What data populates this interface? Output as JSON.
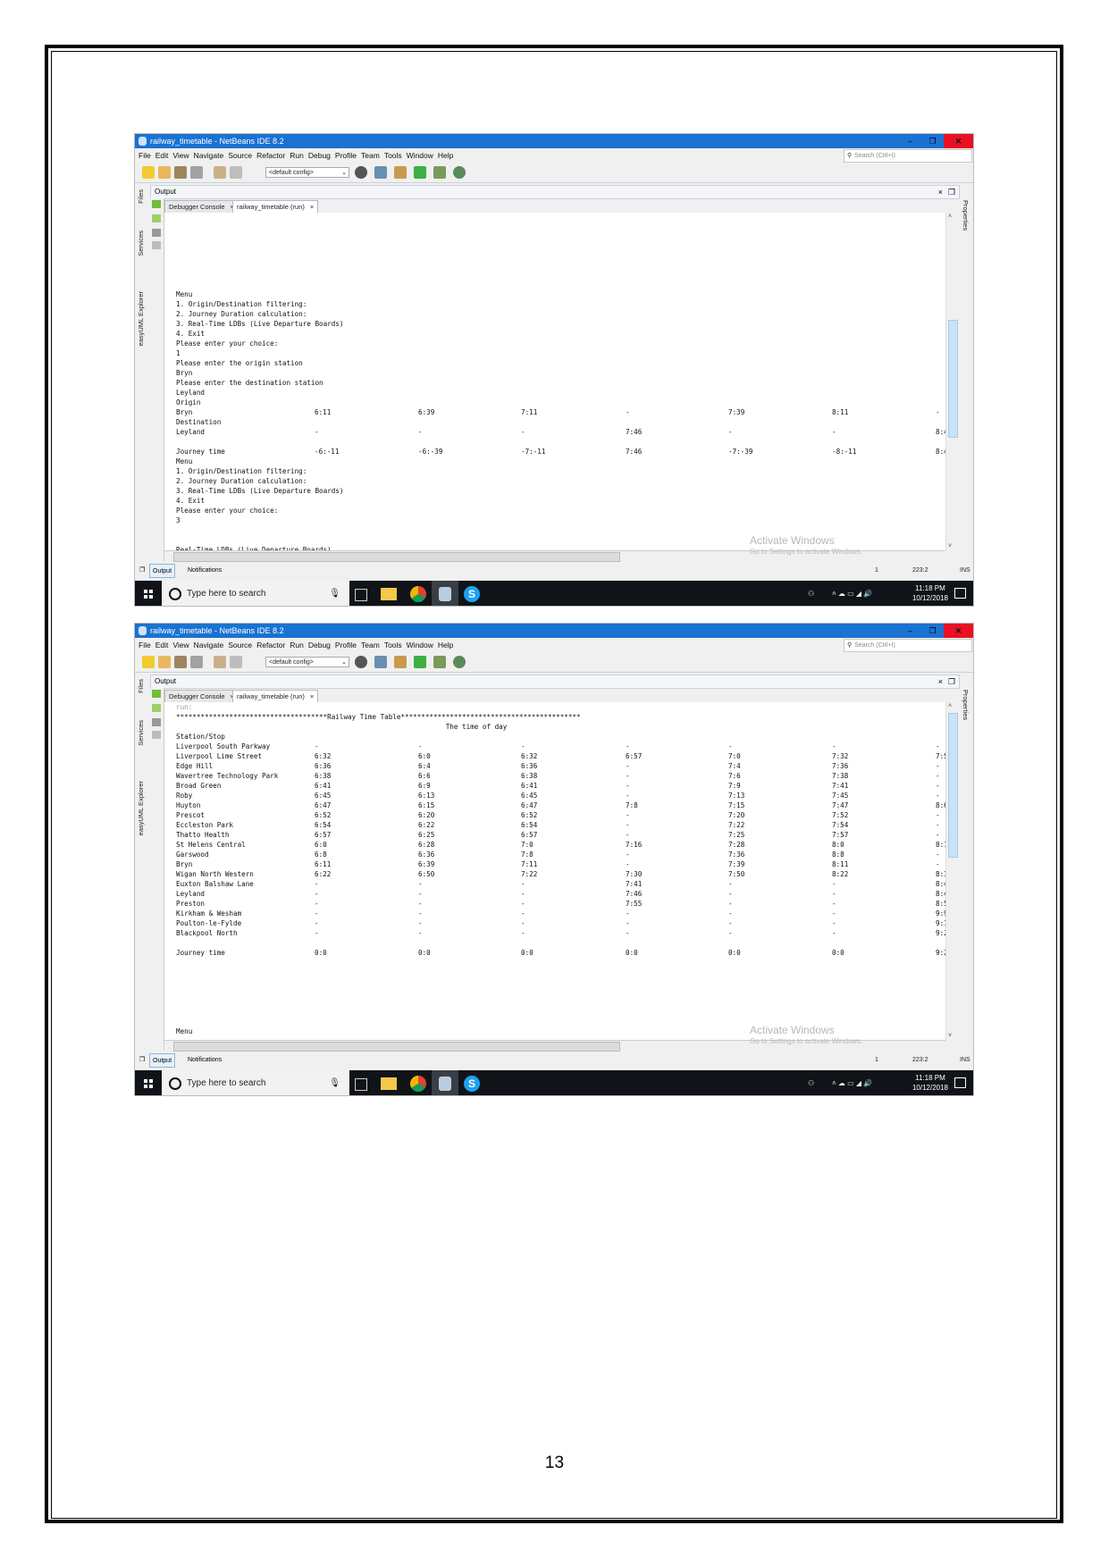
{
  "page_number": "13",
  "screens": [
    {
      "title": "railway_timetable - NetBeans IDE 8.2",
      "window_controls": {
        "minimize": "–",
        "maximize": "❐",
        "close": "✕"
      },
      "menu": [
        "File",
        "Edit",
        "View",
        "Navigate",
        "Source",
        "Refactor",
        "Run",
        "Debug",
        "Profile",
        "Team",
        "Tools",
        "Window",
        "Help"
      ],
      "search_placeholder": "Search (Ctrl+I)",
      "config": "<default config>",
      "output_label": "Output",
      "tabs": [
        "Debugger Console",
        "railway_timetable (run)"
      ],
      "left_panels": [
        "Files",
        "Services",
        "easyUML Explorer"
      ],
      "right_panels": [
        "Properties"
      ],
      "bottom_tabs": [
        "Output",
        "Notifications"
      ],
      "status": {
        "notifications": "1",
        "position": "223:2",
        "mode": "INS"
      },
      "watermark": {
        "title": "Activate Windows",
        "subtitle": "Go to Settings to activate Windows."
      },
      "taskbar": {
        "search_placeholder": "Type here to search",
        "time": "11:18 PM",
        "date": "10/12/2018"
      },
      "lines": [
        "Menu",
        "1. Origin/Destination filtering:",
        "2. Journey Duration calculation:",
        "3. Real-Time LDBs (Live Departure Boards)",
        "4. Exit",
        "Please enter your choice:",
        "1",
        "Please enter the origin station",
        "Bryn",
        "Please enter the destination station",
        "Leyland",
        "Origin",
        [
          "Bryn",
          "6:11",
          "6:39",
          "7:11",
          "-",
          "7:39",
          "8:11",
          "-"
        ],
        "Destination",
        [
          "Leyland",
          "-",
          "-",
          "-",
          "7:46",
          "-",
          "-",
          "8:4"
        ],
        "",
        [
          "Journey time",
          "-6:-11",
          "-6:-39",
          "-7:-11",
          "7:46",
          "-7:-39",
          "-8:-11",
          "8:4"
        ],
        "Menu",
        "1. Origin/Destination filtering:",
        "2. Journey Duration calculation:",
        "3. Real-Time LDBs (Live Departure Boards)",
        "4. Exit",
        "Please enter your choice:",
        "3",
        "",
        "",
        "Real-Time LDBs (Live Departure Boards)"
      ]
    },
    {
      "title": "railway_timetable - NetBeans IDE 8.2",
      "window_controls": {
        "minimize": "–",
        "maximize": "❐",
        "close": "✕"
      },
      "menu": [
        "File",
        "Edit",
        "View",
        "Navigate",
        "Source",
        "Refactor",
        "Run",
        "Debug",
        "Profile",
        "Team",
        "Tools",
        "Window",
        "Help"
      ],
      "search_placeholder": "Search (Ctrl+I)",
      "config": "<default config>",
      "output_label": "Output",
      "tabs": [
        "Debugger Console",
        "railway_timetable (run)"
      ],
      "left_panels": [
        "Files",
        "Services",
        "easyUML Explorer"
      ],
      "right_panels": [
        "Properties"
      ],
      "bottom_tabs": [
        "Output",
        "Notifications"
      ],
      "status": {
        "notifications": "1",
        "position": "223:2",
        "mode": "INS"
      },
      "watermark": {
        "title": "Activate Windows",
        "subtitle": "Go to Settings to activate Windows."
      },
      "taskbar": {
        "search_placeholder": "Type here to search",
        "time": "11:18 PM",
        "date": "10/12/2018"
      },
      "lines": [
        "run:",
        "*************************************Railway Time Table********************************************",
        "                                                                  The time of day",
        "Station/Stop",
        [
          "Liverpool South Parkway",
          "-",
          "-",
          "-",
          "-",
          "-",
          "-",
          "-"
        ],
        [
          "Liverpool Lime Street",
          "6:32",
          "6:0",
          "6:32",
          "6:57",
          "7:0",
          "7:32",
          "7:5"
        ],
        [
          "Edge Hill",
          "6:36",
          "6:4",
          "6:36",
          "-",
          "7:4",
          "7:36",
          "-"
        ],
        [
          "Wavertree Technology Park",
          "6:38",
          "6:6",
          "6:38",
          "-",
          "7:6",
          "7:38",
          "-"
        ],
        [
          "Broad Green",
          "6:41",
          "6:9",
          "6:41",
          "-",
          "7:9",
          "7:41",
          "-"
        ],
        [
          "Roby",
          "6:45",
          "6:13",
          "6:45",
          "-",
          "7:13",
          "7:45",
          "-"
        ],
        [
          "Huyton",
          "6:47",
          "6:15",
          "6:47",
          "7:8",
          "7:15",
          "7:47",
          "8:6"
        ],
        [
          "Prescot",
          "6:52",
          "6:20",
          "6:52",
          "-",
          "7:20",
          "7:52",
          "-"
        ],
        [
          "Eccleston Park",
          "6:54",
          "6:22",
          "6:54",
          "-",
          "7:22",
          "7:54",
          "-"
        ],
        [
          "Thatto Health",
          "6:57",
          "6:25",
          "6:57",
          "-",
          "7:25",
          "7:57",
          "-"
        ],
        [
          "St Helens Central",
          "6:0",
          "6:28",
          "7:0",
          "7:16",
          "7:28",
          "8:0",
          "8:1"
        ],
        [
          "Garswood",
          "6:8",
          "6:36",
          "7:8",
          "-",
          "7:36",
          "8:8",
          "-"
        ],
        [
          "Bryn",
          "6:11",
          "6:39",
          "7:11",
          "-",
          "7:39",
          "8:11",
          "-"
        ],
        [
          "Wigan North Western",
          "6:22",
          "6:50",
          "7:22",
          "7:30",
          "7:50",
          "8:22",
          "8:3"
        ],
        [
          "Euxton Balshaw Lane",
          "-",
          "-",
          "-",
          "7:41",
          "-",
          "-",
          "8:4"
        ],
        [
          "Leyland",
          "-",
          "-",
          "-",
          "7:46",
          "-",
          "-",
          "8:4"
        ],
        [
          "Preston",
          "-",
          "-",
          "-",
          "7:55",
          "-",
          "-",
          "8:5"
        ],
        [
          "Kirkham & Wesham",
          "-",
          "-",
          "-",
          "-",
          "-",
          "-",
          "9:9"
        ],
        [
          "Poulton-le-Fylde",
          "-",
          "-",
          "-",
          "-",
          "-",
          "-",
          "9:1"
        ],
        [
          "Blackpool North",
          "-",
          "-",
          "-",
          "-",
          "-",
          "-",
          "9:2"
        ],
        "",
        [
          "Journey time",
          "0:0",
          "0:0",
          "0:0",
          "0:0",
          "0:0",
          "0:0",
          "9:2"
        ],
        "",
        "",
        "",
        "",
        "",
        "",
        "",
        "Menu"
      ]
    }
  ]
}
